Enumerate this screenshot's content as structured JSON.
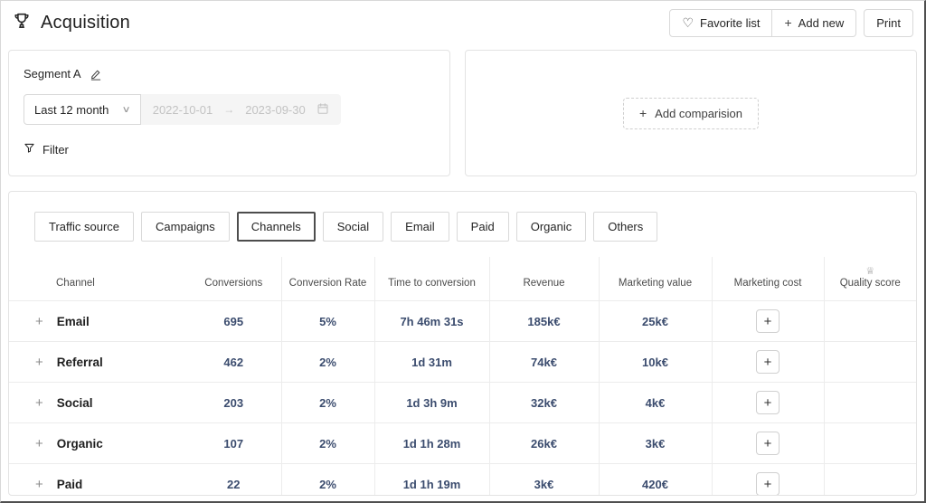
{
  "icons": {
    "heart": "♡",
    "plus": "+",
    "chevron_down": "∨",
    "arrow_right": "→",
    "crown": "♕"
  },
  "colors": {
    "value_text": "#3b4c6e",
    "active_tab_border": "#4d4d4d"
  },
  "header": {
    "title": "Acquisition",
    "favorite_button": "Favorite list",
    "add_new_button": "Add new",
    "print_button": "Print"
  },
  "segment": {
    "name": "Segment A",
    "period": "Last 12 month",
    "date_start": "2022-10-01",
    "date_end": "2023-09-30",
    "filter_label": "Filter"
  },
  "comparison": {
    "add_label": "Add comparision"
  },
  "tabs": [
    {
      "label": "Traffic source",
      "active": false
    },
    {
      "label": "Campaigns",
      "active": false
    },
    {
      "label": "Channels",
      "active": true
    },
    {
      "label": "Social",
      "active": false
    },
    {
      "label": "Email",
      "active": false
    },
    {
      "label": "Paid",
      "active": false
    },
    {
      "label": "Organic",
      "active": false
    },
    {
      "label": "Others",
      "active": false
    }
  ],
  "table": {
    "columns": [
      "Channel",
      "Conversions",
      "Conversion Rate",
      "Time to conversion",
      "Revenue",
      "Marketing value",
      "Marketing cost",
      "Quality score"
    ],
    "rows": [
      {
        "channel": "Email",
        "conversions": "695",
        "conversion_rate": "5%",
        "time_to_conversion": "7h 46m 31s",
        "revenue": "185k€",
        "marketing_value": "25k€"
      },
      {
        "channel": "Referral",
        "conversions": "462",
        "conversion_rate": "2%",
        "time_to_conversion": "1d 31m",
        "revenue": "74k€",
        "marketing_value": "10k€"
      },
      {
        "channel": "Social",
        "conversions": "203",
        "conversion_rate": "2%",
        "time_to_conversion": "1d 3h 9m",
        "revenue": "32k€",
        "marketing_value": "4k€"
      },
      {
        "channel": "Organic",
        "conversions": "107",
        "conversion_rate": "2%",
        "time_to_conversion": "1d 1h 28m",
        "revenue": "26k€",
        "marketing_value": "3k€"
      },
      {
        "channel": "Paid",
        "conversions": "22",
        "conversion_rate": "2%",
        "time_to_conversion": "1d 1h 19m",
        "revenue": "3k€",
        "marketing_value": "420€"
      }
    ]
  }
}
